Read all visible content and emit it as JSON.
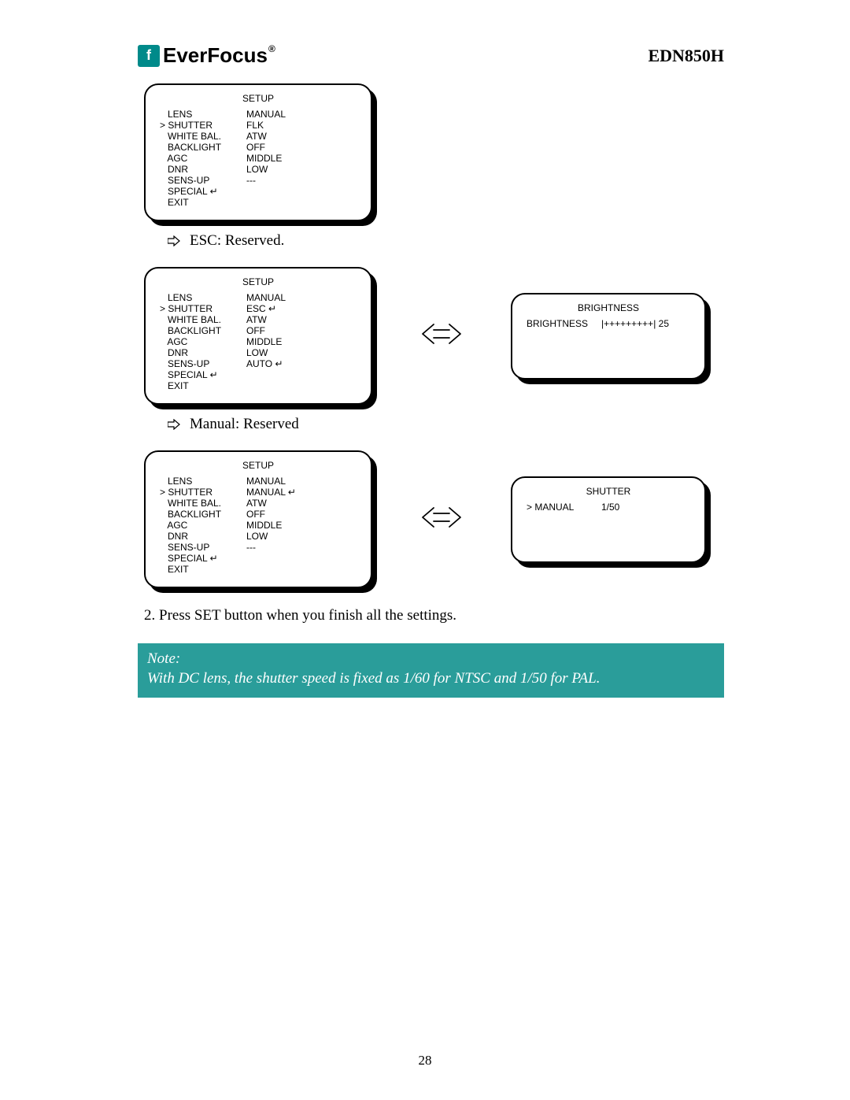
{
  "brand": "EverFocus",
  "model": "EDN850H",
  "box1": {
    "title": "SETUP",
    "rows": [
      {
        "l": "   LENS",
        "r": "MANUAL"
      },
      {
        "l": "> SHUTTER",
        "r": "FLK"
      },
      {
        "l": "   WHITE BAL.",
        "r": "ATW"
      },
      {
        "l": "   BACKLIGHT",
        "r": "OFF"
      },
      {
        "l": "   AGC",
        "r": "MIDDLE"
      },
      {
        "l": "   DNR",
        "r": "LOW"
      },
      {
        "l": "   SENS-UP",
        "r": "---"
      },
      {
        "l": "   SPECIAL ↵",
        "r": ""
      },
      {
        "l": "   EXIT",
        "r": ""
      }
    ]
  },
  "bullet1": "ESC: Reserved.",
  "box2": {
    "title": "SETUP",
    "rows": [
      {
        "l": "   LENS",
        "r": "MANUAL"
      },
      {
        "l": "> SHUTTER",
        "r": "ESC ↵"
      },
      {
        "l": "   WHITE BAL.",
        "r": "ATW"
      },
      {
        "l": "   BACKLIGHT",
        "r": "OFF"
      },
      {
        "l": "   AGC",
        "r": "MIDDLE"
      },
      {
        "l": "   DNR",
        "r": "LOW"
      },
      {
        "l": "   SENS-UP",
        "r": "AUTO ↵"
      },
      {
        "l": "   SPECIAL ↵",
        "r": ""
      },
      {
        "l": "   EXIT",
        "r": ""
      }
    ]
  },
  "box2side": {
    "title": "BRIGHTNESS",
    "rows": [
      {
        "l": "BRIGHTNESS",
        "r": "|+++++++++| 25"
      }
    ]
  },
  "bullet2": "Manual: Reserved",
  "box3": {
    "title": "SETUP",
    "rows": [
      {
        "l": "   LENS",
        "r": "MANUAL"
      },
      {
        "l": "> SHUTTER",
        "r": "MANUAL ↵"
      },
      {
        "l": "   WHITE BAL.",
        "r": "ATW"
      },
      {
        "l": "   BACKLIGHT",
        "r": "OFF"
      },
      {
        "l": "   AGC",
        "r": "MIDDLE"
      },
      {
        "l": "   DNR",
        "r": "LOW"
      },
      {
        "l": "   SENS-UP",
        "r": "---"
      },
      {
        "l": "   SPECIAL ↵",
        "r": ""
      },
      {
        "l": "   EXIT",
        "r": ""
      }
    ]
  },
  "box3side": {
    "title": "SHUTTER",
    "rows": [
      {
        "l": "> MANUAL",
        "r": "1/50"
      }
    ]
  },
  "step2": "2.  Press SET button when you finish all the settings.",
  "note_title": "Note:",
  "note_body": "With DC lens, the shutter speed is fixed as 1/60 for NTSC and 1/50 for PAL.",
  "page_number": "28"
}
